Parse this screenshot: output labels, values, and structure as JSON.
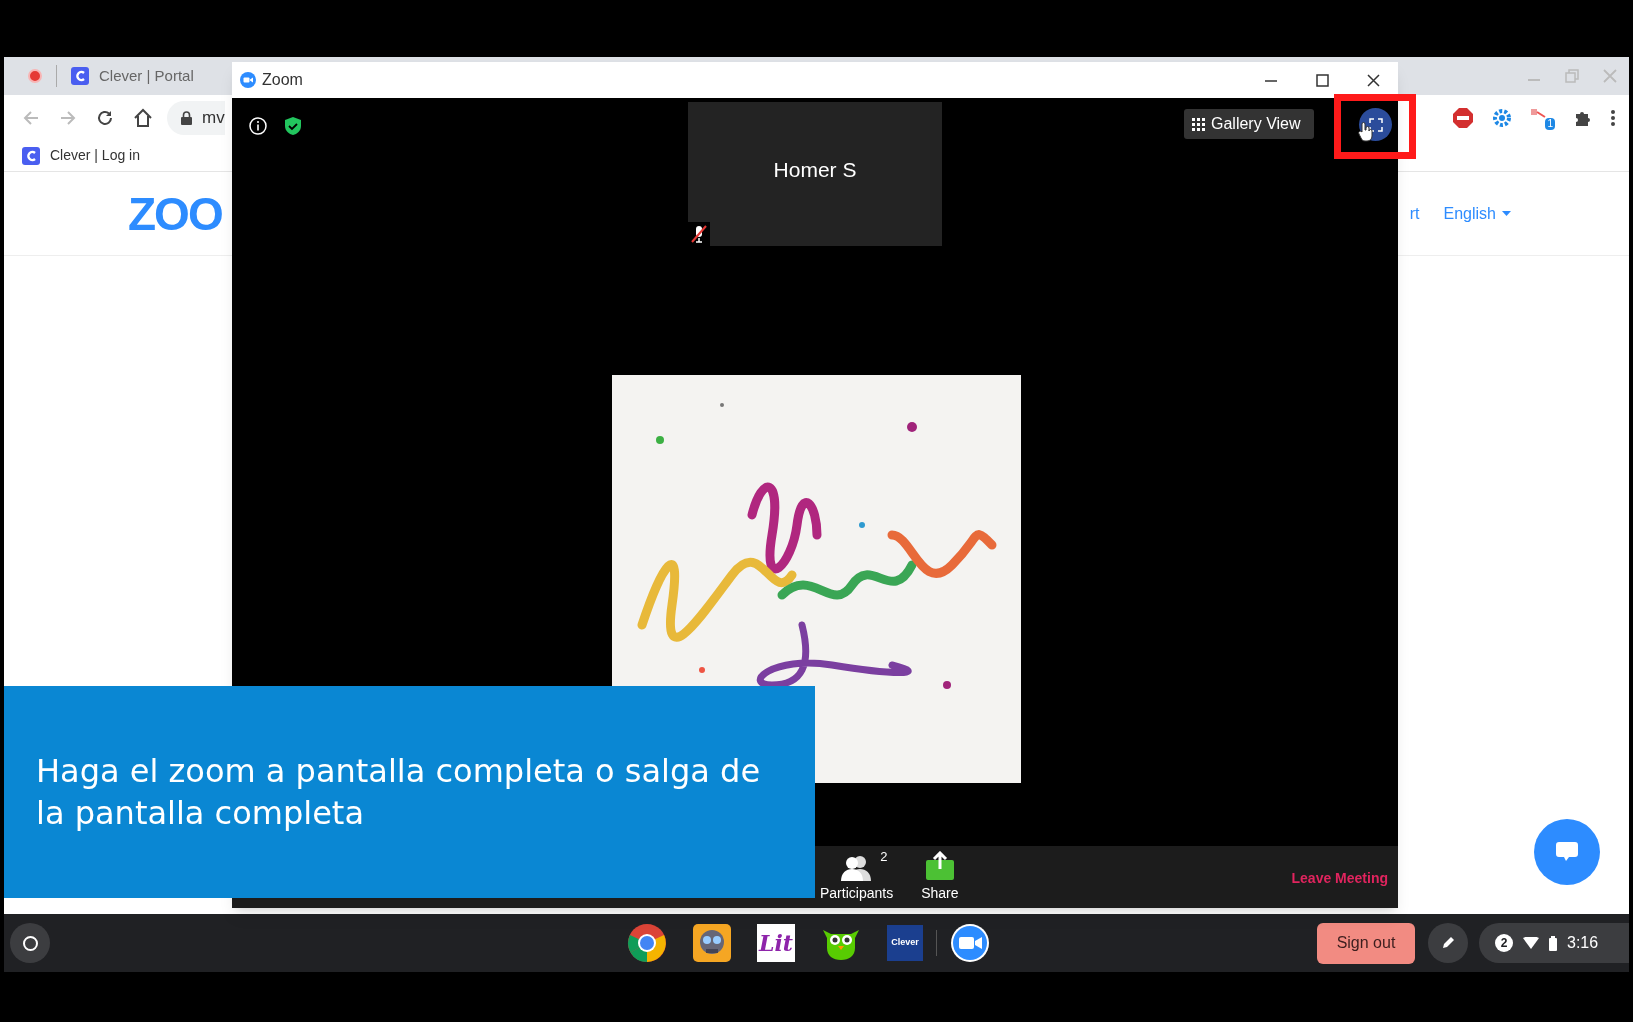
{
  "browser": {
    "tabs": [
      {
        "label": "Clever | Portal"
      }
    ],
    "address": "mv",
    "extension_badge": "1",
    "bookmarks": [
      {
        "label": "Clever | Log in"
      }
    ],
    "page": {
      "logo": "ZOO",
      "nav_link": "rt",
      "language": "English"
    }
  },
  "zoom_window": {
    "title": "Zoom",
    "view_button": "Gallery View",
    "participant": {
      "name": "Homer S",
      "muted": true
    },
    "toolbar": [
      {
        "kind": "participants",
        "label": "Participants",
        "count": "2"
      },
      {
        "kind": "share",
        "label": "Share"
      }
    ],
    "leave": "Leave Meeting"
  },
  "caption": "Haga el zoom a pantalla completa o salga de la pantalla completa",
  "taskbar": {
    "apps": [
      {
        "kind": "chrome"
      },
      {
        "kind": "robot"
      },
      {
        "kind": "lit",
        "label": "Lit"
      },
      {
        "kind": "owl"
      },
      {
        "kind": "clever",
        "label": "Clever"
      },
      {
        "kind": "zoom"
      }
    ],
    "sign_out": "Sign out",
    "notifications": "2",
    "time": "3:16"
  }
}
